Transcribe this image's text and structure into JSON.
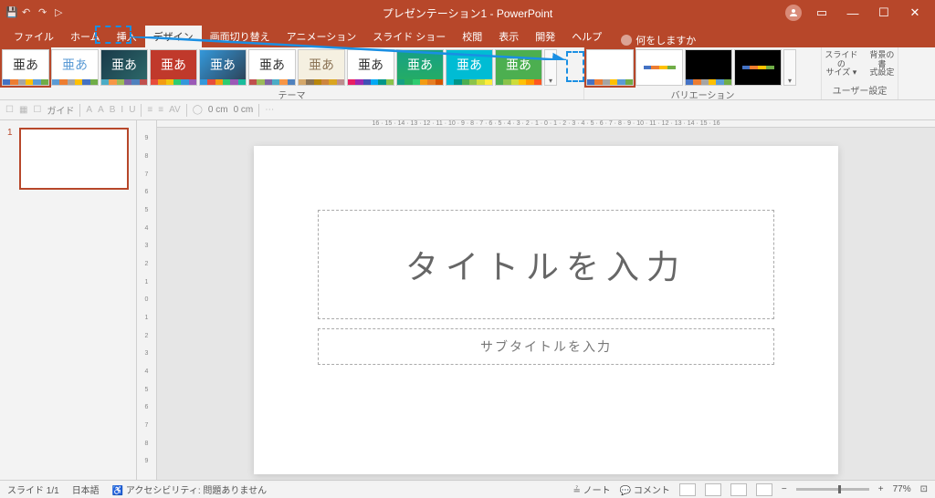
{
  "title": "プレゼンテーション1 - PowerPoint",
  "tabs": {
    "file": "ファイル",
    "home": "ホーム",
    "insert": "挿入",
    "design": "デザイン",
    "transitions": "画面切り替え",
    "animations": "アニメーション",
    "slideshow": "スライド ショー",
    "review": "校閲",
    "view": "表示",
    "developer": "開発",
    "help": "ヘルプ",
    "tellme": "何をしますか"
  },
  "ribbon": {
    "themes_label": "テーマ",
    "variations_label": "バリエーション",
    "user_settings_label": "ユーザー設定",
    "slide_size": "スライドの\nサイズ ▾",
    "bg_format": "背景の書\n式設定",
    "sample": "亜あ"
  },
  "qat2": {
    "guide": "ガイド",
    "cm1": "0 cm",
    "cm2": "0 cm"
  },
  "slide": {
    "title_placeholder": "タイトルを入力",
    "subtitle_placeholder": "サブタイトルを入力",
    "num": "1"
  },
  "ruler": {
    "h": "16 · 15 · 14 · 13 · 12 · 11 · 10 · 9 · 8 · 7 · 6 · 5 · 4 · 3 · 2 · 1 · 0 · 1 · 2 · 3 · 4 · 5 · 6 · 7 · 8 · 9 · 10 · 11 · 12 · 13 · 14 · 15 · 16",
    "v": [
      "9",
      "8",
      "7",
      "6",
      "5",
      "4",
      "3",
      "2",
      "1",
      "0",
      "1",
      "2",
      "3",
      "4",
      "5",
      "6",
      "7",
      "8",
      "9"
    ]
  },
  "status": {
    "slide": "スライド 1/1",
    "lang": "日本語",
    "a11y": "アクセシビリティ: 問題ありません",
    "notes": "ノート",
    "comments": "コメント",
    "zoom": "77%"
  },
  "colors": {
    "accent": "#b7472a",
    "annotation": "#1a8fe3"
  }
}
